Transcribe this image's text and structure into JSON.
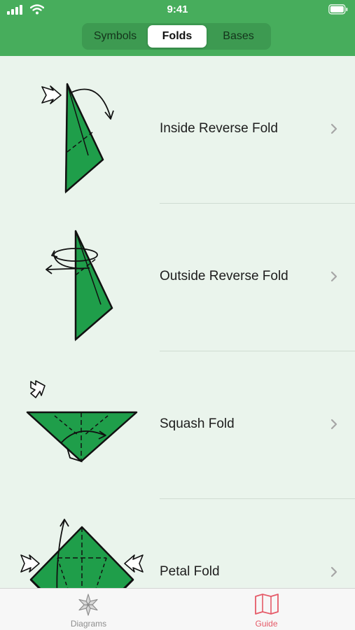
{
  "status_bar": {
    "time": "9:41"
  },
  "segments": [
    {
      "label": "Symbols",
      "selected": false
    },
    {
      "label": "Folds",
      "selected": true
    },
    {
      "label": "Bases",
      "selected": false
    }
  ],
  "folds": [
    {
      "label": "Inside Reverse Fold",
      "illustration": "inside-reverse-fold-diagram"
    },
    {
      "label": "Outside Reverse Fold",
      "illustration": "outside-reverse-fold-diagram"
    },
    {
      "label": "Squash Fold",
      "illustration": "squash-fold-diagram"
    },
    {
      "label": "Petal Fold",
      "illustration": "petal-fold-diagram"
    }
  ],
  "tab_bar": {
    "items": [
      {
        "label": "Diagrams",
        "icon": "origami-flower-icon",
        "selected": false
      },
      {
        "label": "Guide",
        "icon": "map-icon",
        "selected": true
      }
    ]
  },
  "colors": {
    "header": "#47ad5c",
    "paper": "#1f9e4a",
    "background": "#eaf4ec",
    "selected_tab": "#e55a68"
  }
}
